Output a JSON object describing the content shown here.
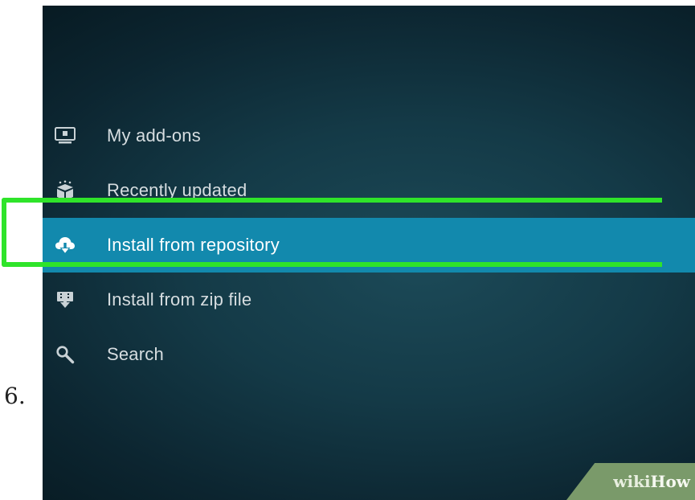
{
  "step": {
    "number": "6."
  },
  "menu": {
    "items": [
      {
        "label": "My add-ons",
        "icon": "monitor-icon",
        "selected": false
      },
      {
        "label": "Recently updated",
        "icon": "box-icon",
        "selected": false
      },
      {
        "label": "Install from repository",
        "icon": "cloud-download-icon",
        "selected": true
      },
      {
        "label": "Install from zip file",
        "icon": "zip-download-icon",
        "selected": false
      },
      {
        "label": "Search",
        "icon": "search-icon",
        "selected": false
      }
    ]
  },
  "watermark": {
    "part1": "wiki",
    "part2": "How"
  },
  "colors": {
    "background_dark": "#0c2530",
    "selected_row": "#1289ad",
    "highlight_outline": "#2fe42a",
    "text": "#d6dde0"
  }
}
